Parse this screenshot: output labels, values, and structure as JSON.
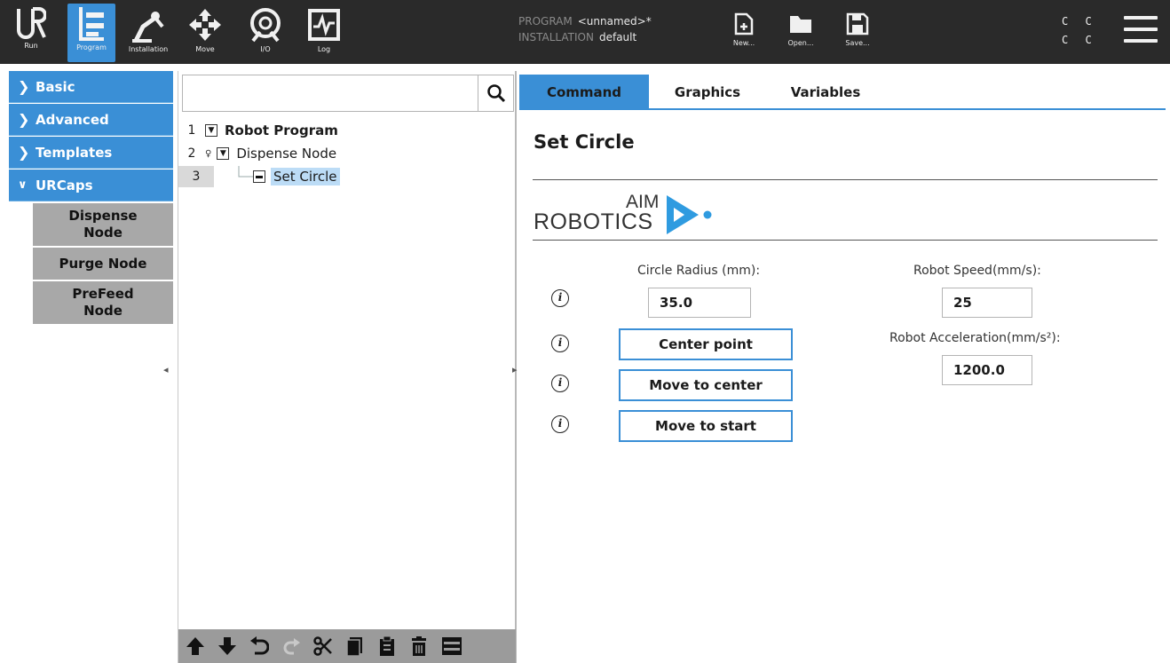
{
  "topbar": {
    "nav": [
      {
        "label": "Run",
        "icon": "ur-logo-icon"
      },
      {
        "label": "Program",
        "icon": "program-icon",
        "active": true
      },
      {
        "label": "Installation",
        "icon": "installation-icon"
      },
      {
        "label": "Move",
        "icon": "move-icon"
      },
      {
        "label": "I/O",
        "icon": "io-icon"
      },
      {
        "label": "Log",
        "icon": "log-icon"
      }
    ],
    "program_label": "PROGRAM",
    "program_value": "<unnamed>*",
    "installation_label": "INSTALLATION",
    "installation_value": "default",
    "file_buttons": [
      {
        "label": "New...",
        "icon": "new-file-icon"
      },
      {
        "label": "Open...",
        "icon": "open-folder-icon"
      },
      {
        "label": "Save...",
        "icon": "save-icon"
      }
    ],
    "status_top": "C C",
    "status_bottom": "C C"
  },
  "sidebar": {
    "categories": [
      {
        "label": "Basic",
        "expanded": false
      },
      {
        "label": "Advanced",
        "expanded": false
      },
      {
        "label": "Templates",
        "expanded": false
      },
      {
        "label": "URCaps",
        "expanded": true
      }
    ],
    "urcaps_items": [
      "Dispense Node",
      "Purge Node",
      "PreFeed Node"
    ]
  },
  "tree": {
    "search_placeholder": "",
    "rows": [
      {
        "num": "1",
        "label": "Robot Program"
      },
      {
        "num": "2",
        "label": "Dispense Node"
      },
      {
        "num": "3",
        "label": "Set Circle"
      }
    ]
  },
  "tabs": [
    "Command",
    "Graphics",
    "Variables"
  ],
  "command": {
    "title": "Set Circle",
    "logo_aim": "AIM",
    "logo_robotics": "ROBOTICS",
    "radius_label": "Circle Radius (mm):",
    "radius_value": "35.0",
    "speed_label": "Robot Speed(mm/s):",
    "speed_value": "25",
    "accel_label": "Robot Acceleration(mm/s²):",
    "accel_value": "1200.0",
    "btn_center_point": "Center point",
    "btn_move_center": "Move to center",
    "btn_move_start": "Move to start",
    "info_glyph": "i"
  },
  "colors": {
    "accent": "#3a8fd6",
    "topbar": "#2a2a2a",
    "submenu": "#a8a8a8",
    "logo_arrow": "#2f9be0"
  }
}
